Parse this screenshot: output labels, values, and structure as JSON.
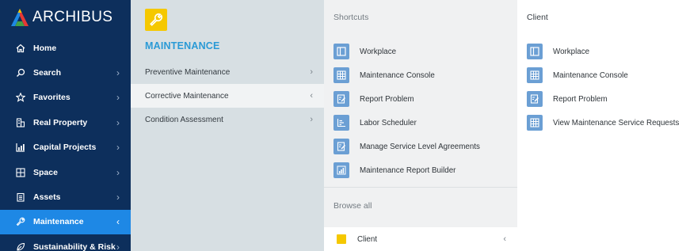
{
  "brand": {
    "name": "ARCHIBUS",
    "logo_colors": [
      "#f5c800",
      "#1e88e5",
      "#e53935",
      "#43a047"
    ]
  },
  "nav": {
    "items": [
      {
        "label": "Home",
        "icon": "home-icon",
        "chevron": ""
      },
      {
        "label": "Search",
        "icon": "search-icon",
        "chevron": "›"
      },
      {
        "label": "Favorites",
        "icon": "star-icon",
        "chevron": "›"
      },
      {
        "label": "Real Property",
        "icon": "building-icon",
        "chevron": "›"
      },
      {
        "label": "Capital Projects",
        "icon": "chart-icon",
        "chevron": "›"
      },
      {
        "label": "Space",
        "icon": "floorplan-icon",
        "chevron": "›"
      },
      {
        "label": "Assets",
        "icon": "clipboard-icon",
        "chevron": "›"
      },
      {
        "label": "Maintenance",
        "icon": "wrench-icon",
        "chevron": "‹"
      },
      {
        "label": "Sustainability & Risk",
        "icon": "leaf-icon",
        "chevron": "›"
      }
    ]
  },
  "submenu": {
    "title": "MAINTENANCE",
    "icon": "wrench-icon",
    "icon_color": "#f5c800",
    "items": [
      {
        "label": "Preventive Maintenance",
        "chevron": "›"
      },
      {
        "label": "Corrective Maintenance",
        "chevron": "‹"
      },
      {
        "label": "Condition Assessment",
        "chevron": "›"
      }
    ]
  },
  "shortcuts": {
    "heading": "Shortcuts",
    "items": [
      {
        "label": "Workplace",
        "icon": "layout-icon"
      },
      {
        "label": "Maintenance Console",
        "icon": "grid-icon"
      },
      {
        "label": "Report Problem",
        "icon": "edit-form-icon"
      },
      {
        "label": "Labor Scheduler",
        "icon": "bar-chart-icon"
      },
      {
        "label": "Manage Service Level Agreements",
        "icon": "edit-form-icon"
      },
      {
        "label": "Maintenance Report Builder",
        "icon": "column-chart-icon"
      }
    ],
    "browse_heading": "Browse all",
    "browse_item": {
      "label": "Client",
      "chevron": "‹",
      "color": "#f5c800"
    }
  },
  "client": {
    "heading": "Client",
    "items": [
      {
        "label": "Workplace",
        "icon": "layout-icon"
      },
      {
        "label": "Maintenance Console",
        "icon": "grid-icon"
      },
      {
        "label": "Report Problem",
        "icon": "edit-form-icon"
      },
      {
        "label": "View Maintenance Service Requests",
        "icon": "grid-icon"
      }
    ]
  },
  "colors": {
    "nav_bg": "#0d2f5c",
    "active": "#1e88e5",
    "tile_icon": "#6b9fd4"
  }
}
